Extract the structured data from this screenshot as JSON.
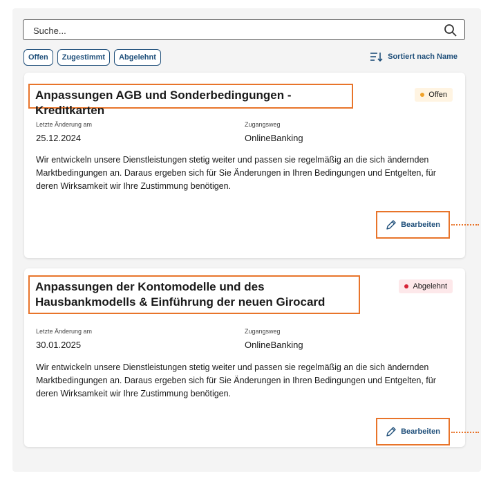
{
  "search": {
    "placeholder": "Suche...",
    "icon": "search-icon"
  },
  "filters": [
    {
      "label": "Offen"
    },
    {
      "label": "Zugestimmt"
    },
    {
      "label": "Abgelehnt"
    }
  ],
  "sort": {
    "label": "Sortiert nach Name",
    "icon": "sort-icon"
  },
  "labels": {
    "last_change": "Letzte Änderung am",
    "access_path": "Zugangsweg",
    "edit": "Bearbeiten"
  },
  "cards": [
    {
      "title": "Anpassungen AGB und Sonderbedingungen - Kreditkarten",
      "status": "Offen",
      "status_color": "#f0a22a",
      "date": "25.12.2024",
      "channel": "OnlineBanking",
      "description": "Wir entwickeln unsere Dienstleistungen stetig weiter und passen sie regelmäßig an die sich ändernden Marktbedingungen an. Daraus ergeben sich für Sie Änderungen in Ihren Bedingungen und Entgelten, für deren Wirksamkeit wir Ihre Zustimmung benötigen."
    },
    {
      "title": "Anpassungen der Kontomodelle und des Hausbankmodells & Einführung der neuen Girocard",
      "status": "Abgelehnt",
      "status_color": "#d62236",
      "date": "30.01.2025",
      "channel": "OnlineBanking",
      "description": "Wir entwickeln unsere Dienstleistungen stetig weiter und passen sie regelmäßig an die sich ändernden Marktbedingungen an. Daraus ergeben sich für Sie Änderungen in Ihren Bedingungen und Entgelten, für deren Wirksamkeit wir Ihre Zustimmung benötigen."
    }
  ],
  "colors": {
    "accent": "#1f4f7a",
    "highlight": "#e8742a"
  }
}
